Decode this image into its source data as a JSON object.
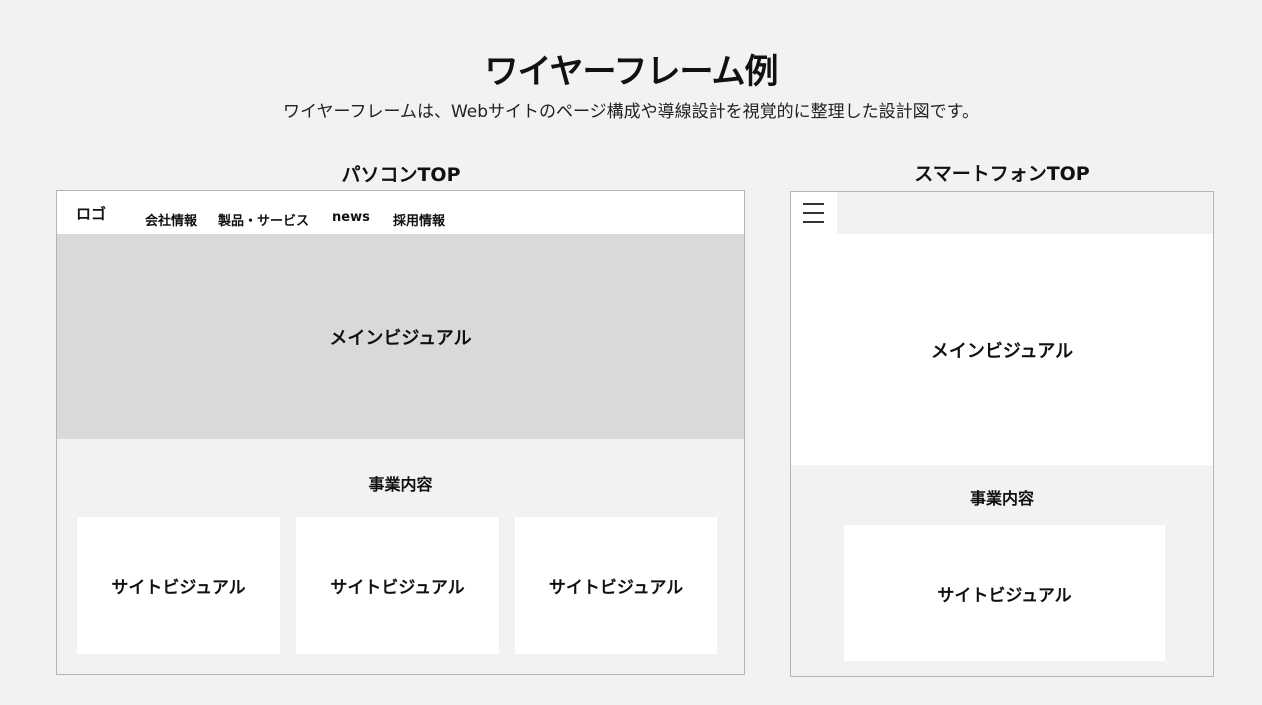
{
  "header": {
    "title": "ワイヤーフレーム例",
    "subtitle": "ワイヤーフレームは、Webサイトのページ構成や導線設計を視覚的に整理した設計図です。"
  },
  "pc": {
    "label": "パソコンTOP",
    "logo": "ロゴ",
    "nav": [
      "会社情報",
      "製品・サービス",
      "news",
      "採用情報"
    ],
    "main_visual": "メインビジュアル",
    "business": "事業内容",
    "cards": [
      "サイトビジュアル",
      "サイトビジュアル",
      "サイトビジュアル"
    ]
  },
  "sp": {
    "label": "スマートフォンTOP",
    "menu_icon": "hamburger-menu-icon",
    "main_visual": "メインビジュアル",
    "business": "事業内容",
    "card": "サイトビジュアル"
  },
  "colors": {
    "background": "#f2f2f2",
    "frame_border": "#b5b5b5",
    "visual_gray": "#d9d9d9",
    "white": "#ffffff"
  }
}
